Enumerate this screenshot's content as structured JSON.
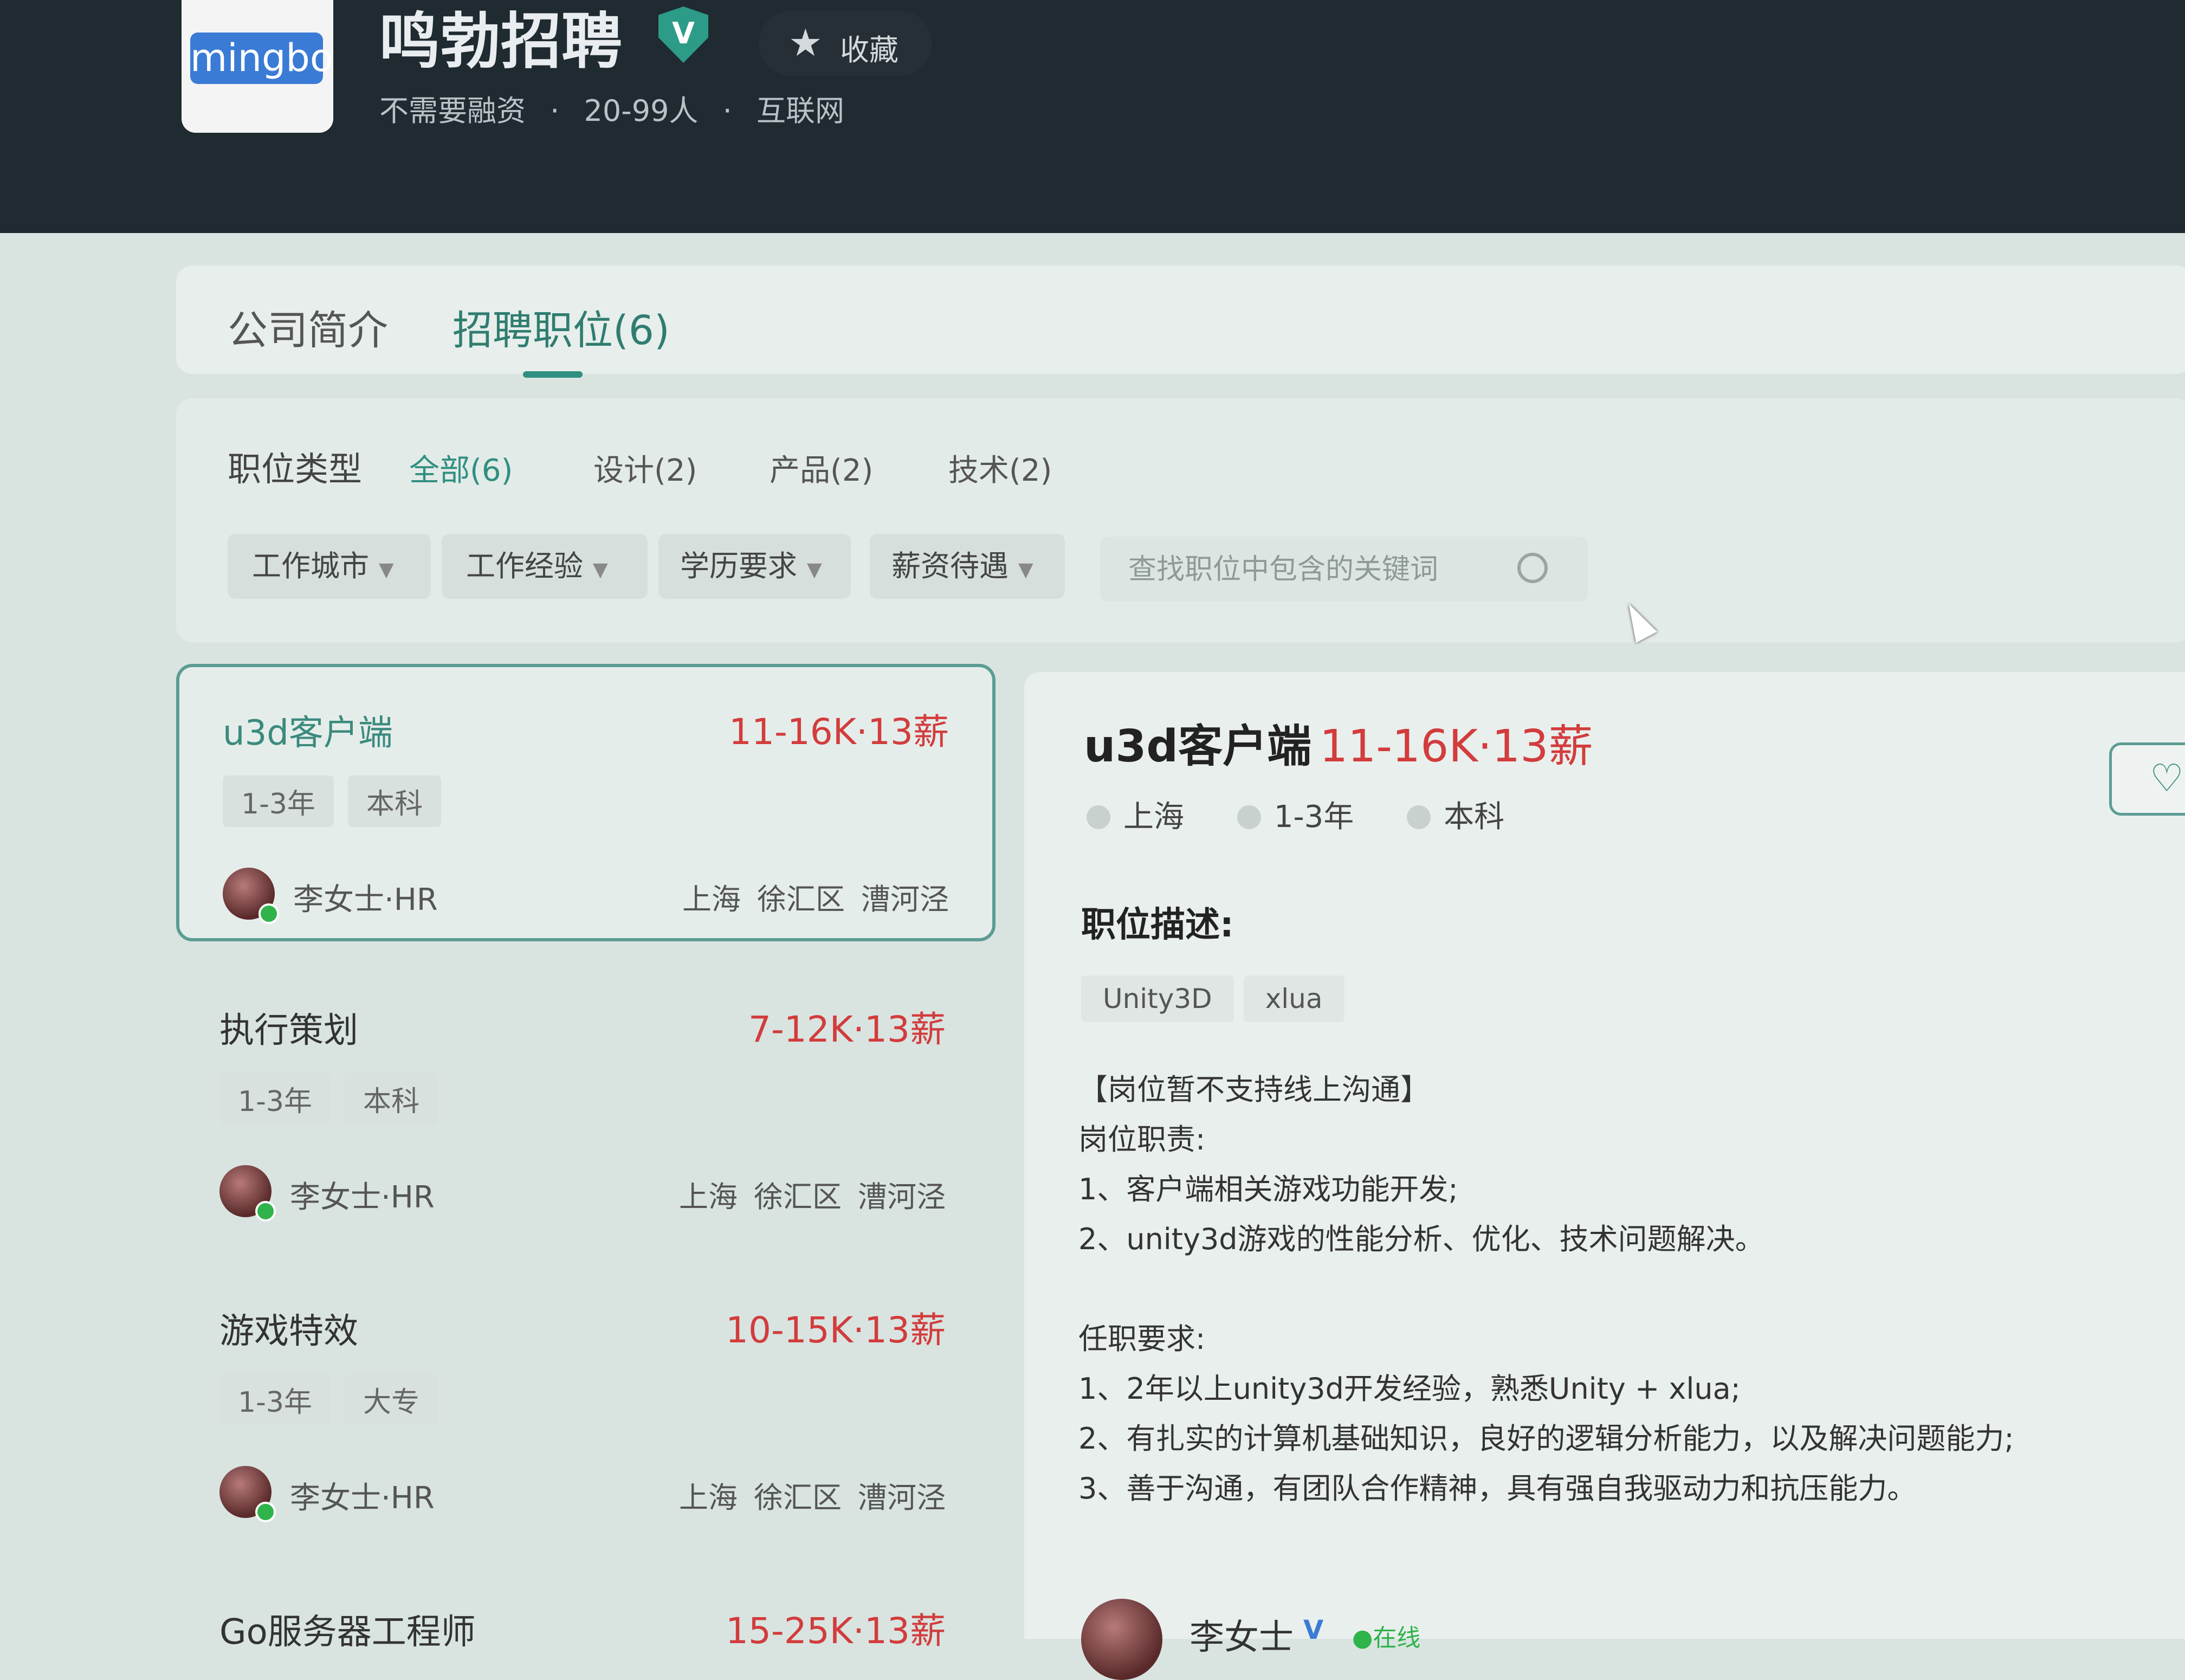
{
  "company": {
    "logo_text": "mingbo",
    "name": "鸣勃招聘",
    "verified_icon": "V",
    "favorite_label": "收藏",
    "meta": [
      "不需要融资",
      "·",
      "20-99人",
      "·",
      "互联网"
    ]
  },
  "tabs": [
    {
      "label": "公司简介"
    },
    {
      "label": "招聘职位(6)"
    }
  ],
  "filters": {
    "type_label": "职位类型",
    "types": [
      "全部(6)",
      "设计(2)",
      "产品(2)",
      "技术(2)"
    ],
    "dropdowns": [
      "工作城市",
      "工作经验",
      "学历要求",
      "薪资待遇"
    ],
    "search_placeholder": "查找职位中包含的关键词"
  },
  "jobs": [
    {
      "title": "u3d客户端",
      "salary": "11-16K·13薪",
      "tags": [
        "1-3年",
        "本科"
      ],
      "hr": "李女士·HR",
      "location": [
        "上海",
        "徐汇区",
        "漕河泾"
      ]
    },
    {
      "title": "执行策划",
      "salary": "7-12K·13薪",
      "tags": [
        "1-3年",
        "本科"
      ],
      "hr": "李女士·HR",
      "location": [
        "上海",
        "徐汇区",
        "漕河泾"
      ]
    },
    {
      "title": "游戏特效",
      "salary": "10-15K·13薪",
      "tags": [
        "1-3年",
        "大专"
      ],
      "hr": "李女士·HR",
      "location": [
        "上海",
        "徐汇区",
        "漕河泾"
      ]
    },
    {
      "title": "Go服务器工程师",
      "salary": "15-25K·13薪"
    }
  ],
  "detail": {
    "title": "u3d客户端",
    "salary": "11-16K·13薪",
    "meta": [
      "上海",
      "1-3年",
      "本科"
    ],
    "section_title": "职位描述:",
    "skills": [
      "Unity3D",
      "xlua"
    ],
    "description": "【岗位暂不支持线上沟通】\n岗位职责:\n1、客户端相关游戏功能开发;\n2、unity3d游戏的性能分析、优化、技术问题解决。\n\n任职要求:\n1、2年以上unity3d开发经验，熟悉Unity + xlua;\n2、有扎实的计算机基础知识，良好的逻辑分析能力，以及解决问题能力;\n3、善于沟通，有团队合作精神，具有强自我驱动力和抗压能力。",
    "hr_name": "李女士",
    "hr_badge": "V",
    "hr_status": "●在线"
  },
  "colors": {
    "accent": "#2f8f80",
    "salary": "#d23c3c",
    "header_bg": "#1f2a31"
  }
}
